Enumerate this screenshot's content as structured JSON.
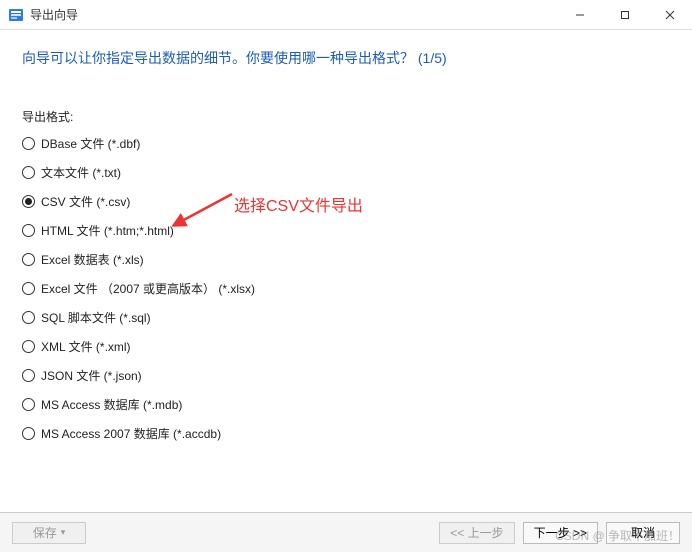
{
  "titlebar": {
    "title": "导出向导"
  },
  "prompt": "向导可以让你指定导出数据的细节。你要使用哪一种导出格式？ (1/5)",
  "section_label": "导出格式:",
  "formats": [
    {
      "label": "DBase 文件 (*.dbf)",
      "selected": false
    },
    {
      "label": "文本文件 (*.txt)",
      "selected": false
    },
    {
      "label": "CSV 文件 (*.csv)",
      "selected": true
    },
    {
      "label": "HTML 文件 (*.htm;*.html)",
      "selected": false
    },
    {
      "label": "Excel 数据表 (*.xls)",
      "selected": false
    },
    {
      "label": "Excel 文件 （2007 或更高版本） (*.xlsx)",
      "selected": false
    },
    {
      "label": "SQL 脚本文件 (*.sql)",
      "selected": false
    },
    {
      "label": "XML 文件 (*.xml)",
      "selected": false
    },
    {
      "label": "JSON 文件 (*.json)",
      "selected": false
    },
    {
      "label": "MS Access 数据库 (*.mdb)",
      "selected": false
    },
    {
      "label": "MS Access 2007 数据库 (*.accdb)",
      "selected": false
    }
  ],
  "annotation_text": "选择CSV文件导出",
  "footer": {
    "save": "保存",
    "back": "<< 上一步",
    "next": "下一步 >>",
    "cancel": "取消"
  },
  "watermark": "CSDN @ 争取不加班！"
}
